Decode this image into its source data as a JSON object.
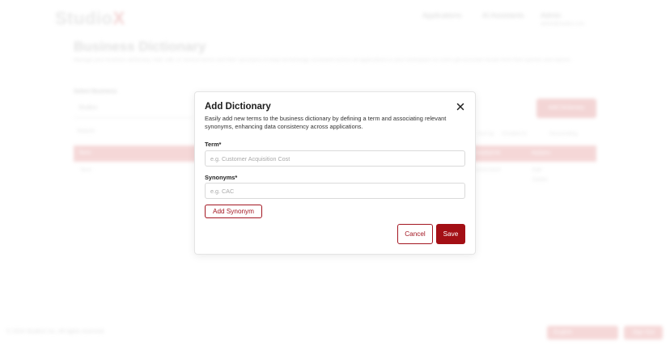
{
  "background": {
    "logo": {
      "text": "Studio",
      "accent": "X"
    },
    "nav": {
      "item1": "Applications",
      "item2": "AI Assistants",
      "item3": "Admin",
      "item3_sub": "admin@studiox.com"
    },
    "page": {
      "title": "Business Dictionary",
      "description": "Manage your business dictionary. Add, edit, or remove terms and their synonyms to keep terminology consistent across all applications in your workspace so users get accurate results from their queries and reports.",
      "select_label": "Select Business",
      "select_value": "Studiox",
      "add_button": "Add Dictionary",
      "search_placeholder": "Search",
      "sort_label": "Sort by",
      "sort_field": "Created At",
      "sort_order": "Descending"
    },
    "table": {
      "col_term": "Term",
      "col_created": "Created At",
      "col_actions": "Actions",
      "row_term": "Term",
      "row_created": "01/01/2024",
      "row_edit": "Edit",
      "row_delete": "Delete"
    },
    "footer": {
      "copyright": "© 2024 StudioX Inc. All rights reserved.",
      "language": "English",
      "signout": "Sign Out"
    }
  },
  "modal": {
    "title": "Add Dictionary",
    "description": "Easily add new terms to the business dictionary by defining a term and associating relevant synonyms, enhancing data consistency across applications.",
    "term_label": "Term*",
    "term_placeholder": "e.g. Customer Acquisition Cost",
    "synonyms_label": "Synonyms*",
    "synonyms_placeholder": "e.g. CAC",
    "add_synonym_label": "Add Synonym",
    "cancel_label": "Cancel",
    "save_label": "Save",
    "close_icon": "close-icon"
  },
  "colors": {
    "brand": "#a30f15",
    "brand_light": "#eab3b3"
  }
}
